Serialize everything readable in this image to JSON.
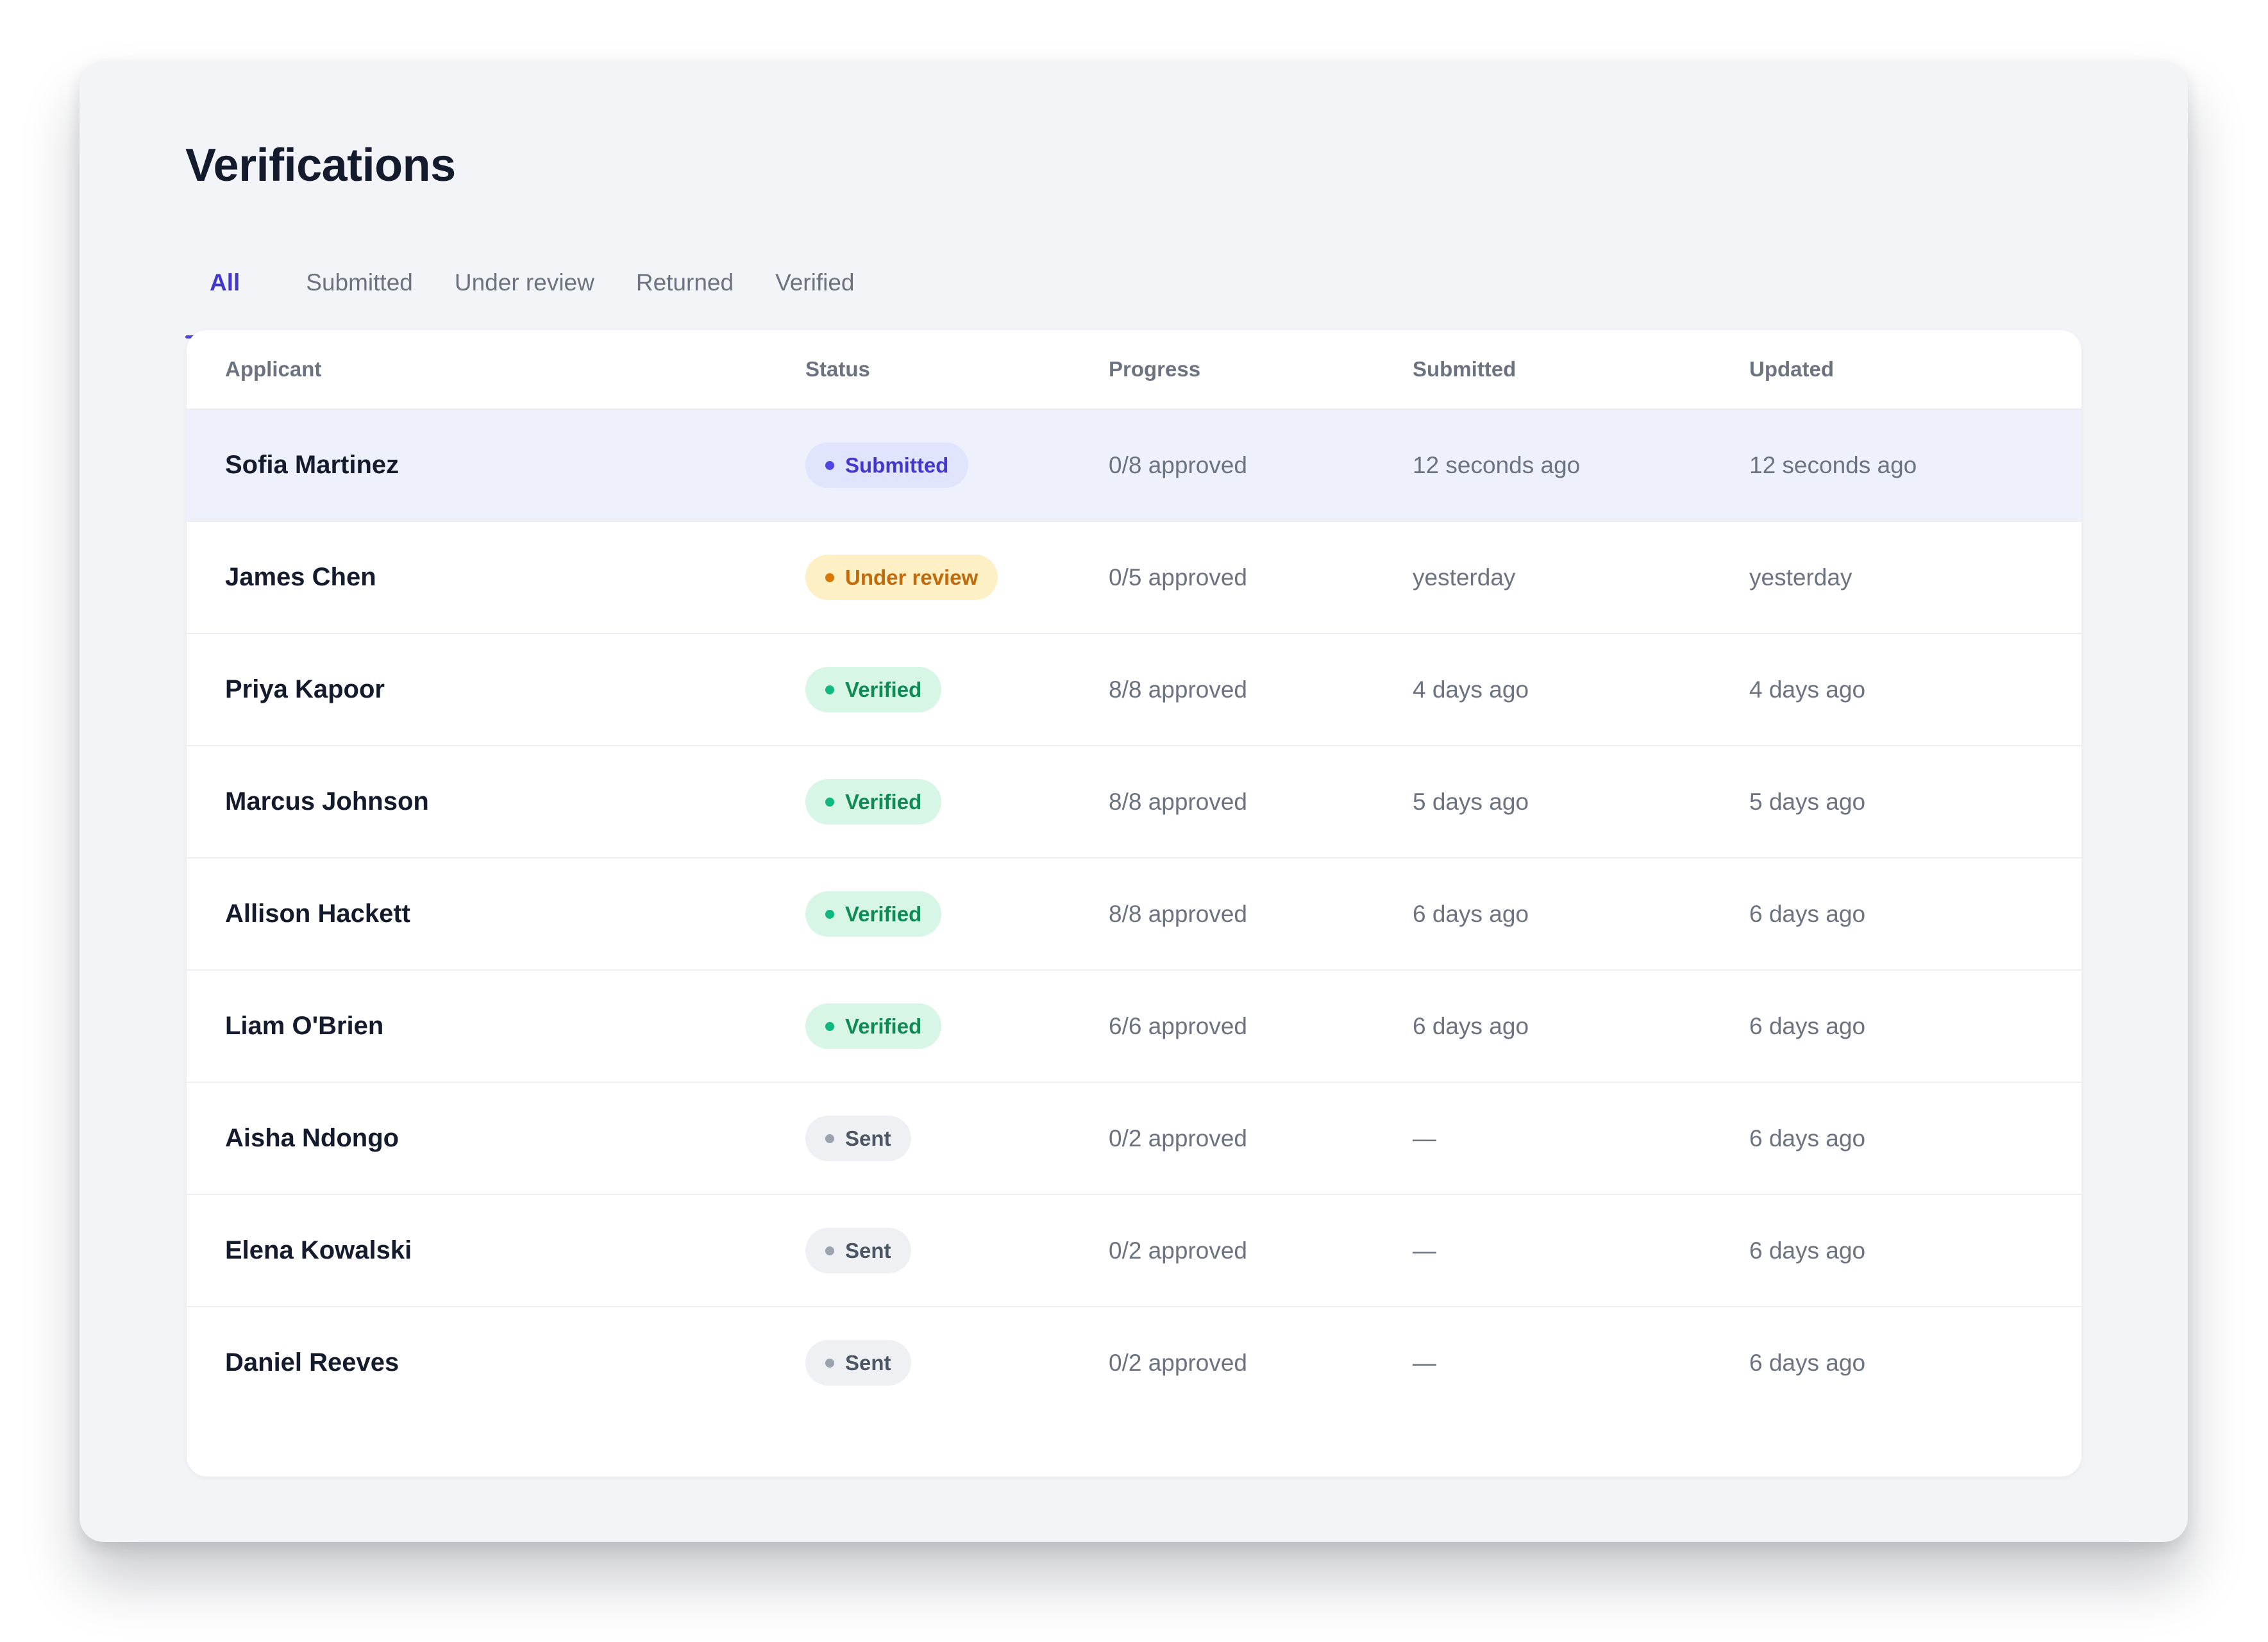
{
  "page": {
    "title": "Verifications"
  },
  "tabs": [
    {
      "label": "All",
      "active": true
    },
    {
      "label": "Submitted",
      "active": false
    },
    {
      "label": "Under review",
      "active": false
    },
    {
      "label": "Returned",
      "active": false
    },
    {
      "label": "Verified",
      "active": false
    }
  ],
  "table": {
    "columns": [
      "Applicant",
      "Status",
      "Progress",
      "Submitted",
      "Updated"
    ],
    "rows": [
      {
        "applicant": "Sofia Martinez",
        "status": "Submitted",
        "status_key": "submitted",
        "progress": "0/8 approved",
        "submitted": "12 seconds ago",
        "updated": "12 seconds ago",
        "selected": true
      },
      {
        "applicant": "James Chen",
        "status": "Under review",
        "status_key": "review",
        "progress": "0/5 approved",
        "submitted": "yesterday",
        "updated": "yesterday",
        "selected": false
      },
      {
        "applicant": "Priya Kapoor",
        "status": "Verified",
        "status_key": "verified",
        "progress": "8/8 approved",
        "submitted": "4 days ago",
        "updated": "4 days ago",
        "selected": false
      },
      {
        "applicant": "Marcus Johnson",
        "status": "Verified",
        "status_key": "verified",
        "progress": "8/8 approved",
        "submitted": "5 days ago",
        "updated": "5 days ago",
        "selected": false
      },
      {
        "applicant": "Allison Hackett",
        "status": "Verified",
        "status_key": "verified",
        "progress": "8/8 approved",
        "submitted": "6 days ago",
        "updated": "6 days ago",
        "selected": false
      },
      {
        "applicant": "Liam O'Brien",
        "status": "Verified",
        "status_key": "verified",
        "progress": "6/6 approved",
        "submitted": "6 days ago",
        "updated": "6 days ago",
        "selected": false
      },
      {
        "applicant": "Aisha Ndongo",
        "status": "Sent",
        "status_key": "sent",
        "progress": "0/2 approved",
        "submitted": "—",
        "updated": "6 days ago",
        "selected": false
      },
      {
        "applicant": "Elena Kowalski",
        "status": "Sent",
        "status_key": "sent",
        "progress": "0/2 approved",
        "submitted": "—",
        "updated": "6 days ago",
        "selected": false
      },
      {
        "applicant": "Daniel Reeves",
        "status": "Sent",
        "status_key": "sent",
        "progress": "0/2 approved",
        "submitted": "—",
        "updated": "6 days ago",
        "selected": false
      }
    ]
  },
  "status_colors": {
    "submitted": {
      "bg": "#e0e4fc",
      "fg": "#4338ca",
      "dot": "#4f46e5"
    },
    "review": {
      "bg": "#fdf0c4",
      "fg": "#c2690a",
      "dot": "#d97706"
    },
    "verified": {
      "bg": "#d7f6e5",
      "fg": "#0f8a55",
      "dot": "#10b981"
    },
    "sent": {
      "bg": "#eff0f3",
      "fg": "#4b5563",
      "dot": "#9ca3af"
    }
  },
  "colors": {
    "accent": "#4f46e5",
    "selected_row_bg": "#eef1fc",
    "page_bg": "#f3f4f8"
  }
}
